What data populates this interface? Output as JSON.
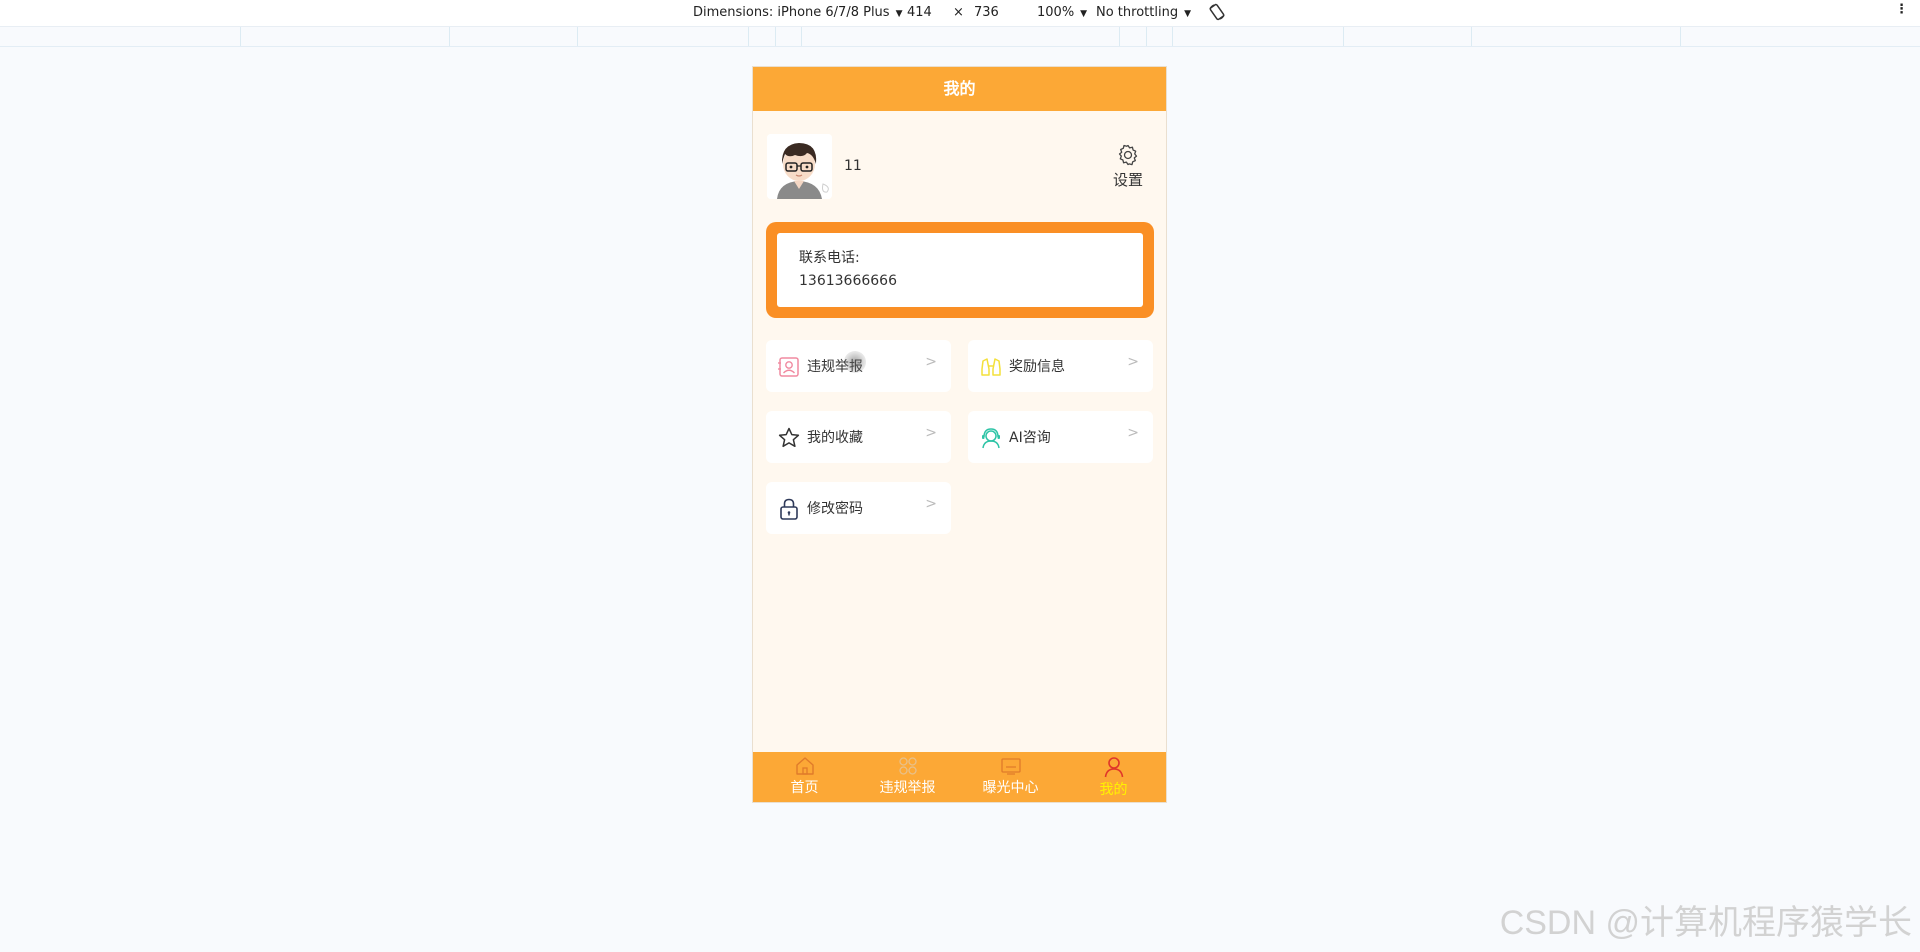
{
  "devtools": {
    "dimensions_label": "Dimensions: iPhone 6/7/8 Plus",
    "width": "414",
    "times": "×",
    "height": "736",
    "zoom": "100%",
    "throttling": "No throttling",
    "rotate_icon": "rotate-icon",
    "more_icon": "kebab-menu-icon"
  },
  "header": {
    "title": "我的"
  },
  "profile": {
    "username": "11",
    "avatar_icon": "cartoon-boy-avatar",
    "settings_label": "设置",
    "settings_icon": "gear-icon"
  },
  "contact": {
    "label": "联系电话:",
    "phone": "13613666666"
  },
  "menu": [
    {
      "label": "违规举报",
      "icon": "report-icon",
      "color": "#f08aa0"
    },
    {
      "label": "奖励信息",
      "icon": "binoculars-icon",
      "color": "#f3e03a"
    },
    {
      "label": "我的收藏",
      "icon": "star-icon",
      "color": "#333333"
    },
    {
      "label": "AI咨询",
      "icon": "headset-agent-icon",
      "color": "#2ec4a6"
    },
    {
      "label": "修改密码",
      "icon": "lock-icon",
      "color": "#2f3a5a"
    }
  ],
  "menu_arrow": ">",
  "tabbar": {
    "tabs": [
      {
        "label": "首页",
        "icon": "home-icon"
      },
      {
        "label": "违规举报",
        "icon": "grid-icon"
      },
      {
        "label": "曝光中心",
        "icon": "screen-icon"
      },
      {
        "label": "我的",
        "icon": "user-icon"
      }
    ],
    "active_index": 3,
    "active_color": "#fff200"
  },
  "colors": {
    "primary": "#fca836",
    "contact_border": "#fa8f25",
    "page_bg": "#fff8ef"
  },
  "watermark": "CSDN @计算机程序猿学长"
}
